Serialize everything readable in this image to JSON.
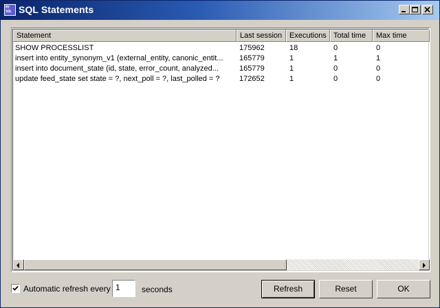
{
  "window": {
    "title": "SQL Statements",
    "app_icon_text": "MY SQL"
  },
  "columns": [
    "Statement",
    "Last session",
    "Executions",
    "Total time",
    "Max time"
  ],
  "rows": [
    {
      "statement": "SHOW PROCESSLIST",
      "last_session": "175962",
      "executions": "18",
      "total_time": "0",
      "max_time": "0"
    },
    {
      "statement": "insert into entity_synonym_v1 (external_entity, canonic_entit...",
      "last_session": "165779",
      "executions": "1",
      "total_time": "1",
      "max_time": "1"
    },
    {
      "statement": "insert into document_state (id, state, error_count, analyzed...",
      "last_session": "165779",
      "executions": "1",
      "total_time": "0",
      "max_time": "0"
    },
    {
      "statement": "update feed_state set state = ?, next_poll = ?, last_polled = ?",
      "last_session": "172652",
      "executions": "1",
      "total_time": "0",
      "max_time": "0"
    }
  ],
  "footer": {
    "auto_refresh_label": "Automatic refresh every",
    "auto_refresh_checked": true,
    "interval_value": "1",
    "seconds_label": "seconds",
    "refresh_button": "Refresh",
    "reset_button": "Reset",
    "ok_button": "OK"
  }
}
